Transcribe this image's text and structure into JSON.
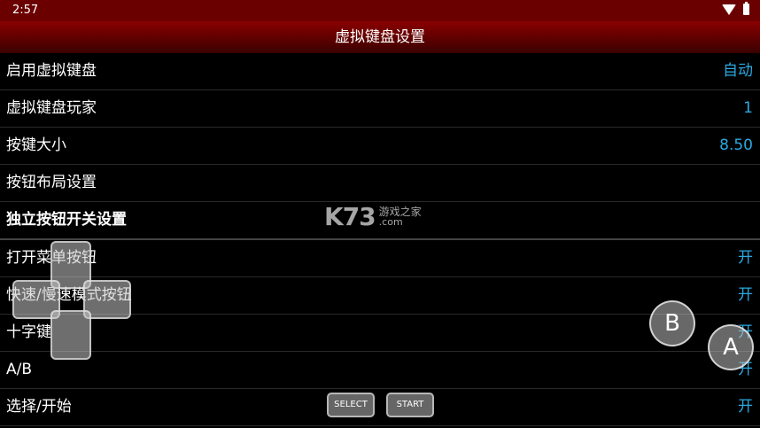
{
  "status": {
    "time": "2:57"
  },
  "title": "虚拟键盘设置",
  "rows": [
    {
      "label": "启用虚拟键盘",
      "value": "自动"
    },
    {
      "label": "虚拟键盘玩家",
      "value": "1"
    },
    {
      "label": "按键大小",
      "value": "8.50"
    },
    {
      "label": "按钮布局设置",
      "value": ""
    },
    {
      "label": "独立按钮开关设置",
      "value": ""
    },
    {
      "label": "打开菜单按钮",
      "value": "开"
    },
    {
      "label": "快速/慢速模式按钮",
      "value": "开"
    },
    {
      "label": "十字键",
      "value": "开"
    },
    {
      "label": "A/B",
      "value": "开"
    },
    {
      "label": "选择/开始",
      "value": "开"
    }
  ],
  "watermark": {
    "logo": "K73",
    "line1": "游戏之家",
    "line2": ".com"
  },
  "gamepad": {
    "b_label": "B",
    "a_label": "A",
    "select_label": "SELECT",
    "start_label": "START"
  }
}
